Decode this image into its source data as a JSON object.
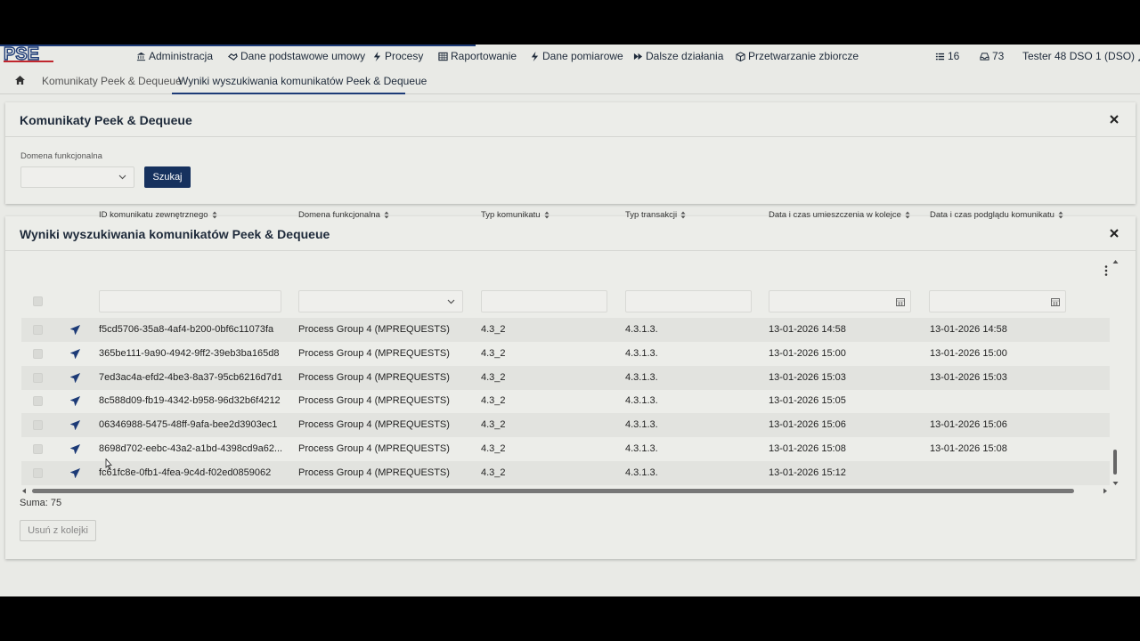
{
  "nav": {
    "items": [
      {
        "label": "Administracja",
        "icon": "bank-icon"
      },
      {
        "label": "Dane podstawowe umowy",
        "icon": "handshake-icon"
      },
      {
        "label": "Procesy",
        "icon": "bolt-icon"
      },
      {
        "label": "Raportowanie",
        "icon": "table-icon"
      },
      {
        "label": "Dane pomiarowe",
        "icon": "bolt-icon"
      },
      {
        "label": "Dalsze działania",
        "icon": "forward-icon"
      },
      {
        "label": "Przetwarzanie zbiorcze",
        "icon": "cube-icon"
      }
    ],
    "tasks_count": "16",
    "messages_count": "73",
    "user": "Tester 48 DSO 1 (DSO)"
  },
  "breadcrumb": {
    "items": [
      "Komunikaty Peek & Dequeue",
      "Wyniki wyszukiwania komunikatów Peek & Dequeue"
    ]
  },
  "search_panel": {
    "title": "Komunikaty Peek & Dequeue",
    "domain_label": "Domena funkcjonalna",
    "domain_value": "",
    "search_button": "Szukaj"
  },
  "results_panel": {
    "title": "Wyniki wyszukiwania komunikatów Peek & Dequeue",
    "columns": [
      "ID komunikatu zewnętrznego",
      "Domena funkcjonalna",
      "Typ komunikatu",
      "Typ transakcji",
      "Data i czas umieszczenia w kolejce",
      "Data i czas podglądu komunikatu"
    ],
    "rows": [
      {
        "id": "f5cd5706-35a8-4af4-b200-0bf6c11073fa",
        "domain": "Process Group 4 (MPREQUESTS)",
        "msg_type": "4.3_2",
        "tx_type": "4.3.1.3.",
        "queued": "13-01-2026 14:58",
        "viewed": "13-01-2026 14:58"
      },
      {
        "id": "365be111-9a90-4942-9ff2-39eb3ba165d8",
        "domain": "Process Group 4 (MPREQUESTS)",
        "msg_type": "4.3_2",
        "tx_type": "4.3.1.3.",
        "queued": "13-01-2026 15:00",
        "viewed": "13-01-2026 15:00"
      },
      {
        "id": "7ed3ac4a-efd2-4be3-8a37-95cb6216d7d1",
        "domain": "Process Group 4 (MPREQUESTS)",
        "msg_type": "4.3_2",
        "tx_type": "4.3.1.3.",
        "queued": "13-01-2026 15:03",
        "viewed": "13-01-2026 15:03"
      },
      {
        "id": "8c588d09-fb19-4342-b958-96d32b6f4212",
        "domain": "Process Group 4 (MPREQUESTS)",
        "msg_type": "4.3_2",
        "tx_type": "4.3.1.3.",
        "queued": "13-01-2026 15:05",
        "viewed": ""
      },
      {
        "id": "06346988-5475-48ff-9afa-bee2d3903ec1",
        "domain": "Process Group 4 (MPREQUESTS)",
        "msg_type": "4.3_2",
        "tx_type": "4.3.1.3.",
        "queued": "13-01-2026 15:06",
        "viewed": "13-01-2026 15:06"
      },
      {
        "id": "8698d702-eebc-43a2-a1bd-4398cd9a62...",
        "domain": "Process Group 4 (MPREQUESTS)",
        "msg_type": "4.3_2",
        "tx_type": "4.3.1.3.",
        "queued": "13-01-2026 15:08",
        "viewed": "13-01-2026 15:08"
      },
      {
        "id": "fc61fc8e-0fb1-4fea-9c4d-f02ed0859062",
        "domain": "Process Group 4 (MPREQUESTS)",
        "msg_type": "4.3_2",
        "tx_type": "4.3.1.3.",
        "queued": "13-01-2026 15:12",
        "viewed": ""
      }
    ],
    "total": "Suma: 75",
    "remove_button": "Usuń z kolejki"
  },
  "colors": {
    "accent": "#16315e",
    "background": "#e9eae6"
  }
}
